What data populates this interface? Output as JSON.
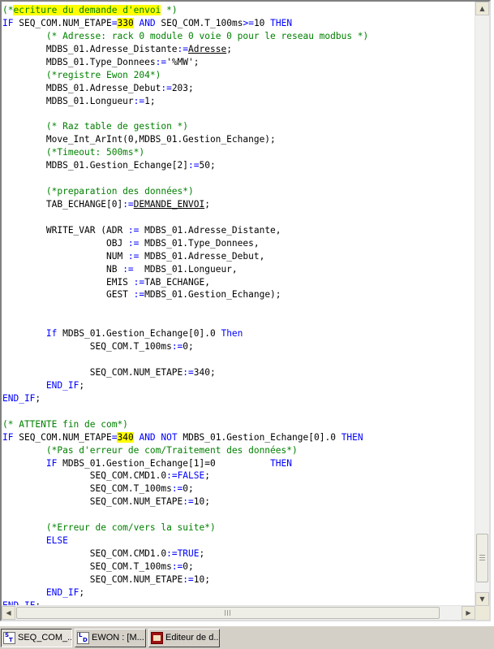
{
  "editor": {
    "lines": [
      {
        "segs": [
          {
            "t": "(*",
            "c": "cm"
          },
          {
            "t": "ecriture du demande d'envoi",
            "c": "cm hl"
          },
          {
            "t": " *)",
            "c": "cm"
          }
        ]
      },
      {
        "segs": [
          {
            "t": "IF",
            "c": "kw"
          },
          {
            "t": " SEQ_COM.NUM_ETAPE"
          },
          {
            "t": "=",
            "c": "kw"
          },
          {
            "t": "330",
            "c": "hl"
          },
          {
            "t": " "
          },
          {
            "t": "AND",
            "c": "kw"
          },
          {
            "t": " SEQ_COM.T_100ms"
          },
          {
            "t": ">=",
            "c": "kw"
          },
          {
            "t": "10 "
          },
          {
            "t": "THEN",
            "c": "kw"
          }
        ]
      },
      {
        "segs": [
          {
            "t": "        "
          },
          {
            "t": "(* Adresse: rack 0 module 0 voie 0 pour le reseau modbus *)",
            "c": "cm"
          }
        ]
      },
      {
        "segs": [
          {
            "t": "        MDBS_01.Adresse_Distante"
          },
          {
            "t": ":=",
            "c": "kw"
          },
          {
            "t": "Adresse",
            "c": "ul"
          },
          {
            "t": ";"
          }
        ]
      },
      {
        "segs": [
          {
            "t": "        MDBS_01.Type_Donnees"
          },
          {
            "t": ":=",
            "c": "kw"
          },
          {
            "t": "'%MW'"
          },
          {
            "t": ";"
          }
        ]
      },
      {
        "segs": [
          {
            "t": "        "
          },
          {
            "t": "(*registre Ewon 204*)",
            "c": "cm"
          }
        ]
      },
      {
        "segs": [
          {
            "t": "        MDBS_01.Adresse_Debut"
          },
          {
            "t": ":=",
            "c": "kw"
          },
          {
            "t": "203;"
          }
        ]
      },
      {
        "segs": [
          {
            "t": "        MDBS_01.Longueur"
          },
          {
            "t": ":=",
            "c": "kw"
          },
          {
            "t": "1;"
          }
        ]
      },
      {
        "segs": []
      },
      {
        "segs": [
          {
            "t": "        "
          },
          {
            "t": "(* Raz table de gestion *)",
            "c": "cm"
          }
        ]
      },
      {
        "segs": [
          {
            "t": "        Move_Int_ArInt(0,MDBS_01.Gestion_Echange);"
          }
        ]
      },
      {
        "segs": [
          {
            "t": "        "
          },
          {
            "t": "(*Timeout: 500ms*)",
            "c": "cm"
          }
        ]
      },
      {
        "segs": [
          {
            "t": "        MDBS_01.Gestion_Echange[2]"
          },
          {
            "t": ":=",
            "c": "kw"
          },
          {
            "t": "50;"
          }
        ]
      },
      {
        "segs": []
      },
      {
        "segs": [
          {
            "t": "        "
          },
          {
            "t": "(*preparation des données*)",
            "c": "cm"
          }
        ]
      },
      {
        "segs": [
          {
            "t": "        TAB_ECHANGE[0]"
          },
          {
            "t": ":=",
            "c": "kw"
          },
          {
            "t": "DEMANDE_ENVOI",
            "c": "ul"
          },
          {
            "t": ";"
          }
        ]
      },
      {
        "segs": []
      },
      {
        "segs": [
          {
            "t": "        WRITE_VAR (ADR "
          },
          {
            "t": ":=",
            "c": "kw"
          },
          {
            "t": " MDBS_01.Adresse_Distante,"
          }
        ]
      },
      {
        "segs": [
          {
            "t": "                   OBJ "
          },
          {
            "t": ":=",
            "c": "kw"
          },
          {
            "t": " MDBS_01.Type_Donnees,"
          }
        ]
      },
      {
        "segs": [
          {
            "t": "                   NUM "
          },
          {
            "t": ":=",
            "c": "kw"
          },
          {
            "t": " MDBS_01.Adresse_Debut,"
          }
        ]
      },
      {
        "segs": [
          {
            "t": "                   NB "
          },
          {
            "t": ":=",
            "c": "kw"
          },
          {
            "t": "  MDBS_01.Longueur,"
          }
        ]
      },
      {
        "segs": [
          {
            "t": "                   EMIS "
          },
          {
            "t": ":=",
            "c": "kw"
          },
          {
            "t": "TAB_ECHANGE,"
          }
        ]
      },
      {
        "segs": [
          {
            "t": "                   GEST "
          },
          {
            "t": ":=",
            "c": "kw"
          },
          {
            "t": "MDBS_01.Gestion_Echange);"
          }
        ]
      },
      {
        "segs": []
      },
      {
        "segs": []
      },
      {
        "segs": [
          {
            "t": "        "
          },
          {
            "t": "If",
            "c": "kw"
          },
          {
            "t": " MDBS_01.Gestion_Echange[0].0 "
          },
          {
            "t": "Then",
            "c": "kw"
          }
        ]
      },
      {
        "segs": [
          {
            "t": "                SEQ_COM.T_100ms"
          },
          {
            "t": ":=",
            "c": "kw"
          },
          {
            "t": "0;"
          }
        ]
      },
      {
        "segs": []
      },
      {
        "segs": [
          {
            "t": "                SEQ_COM.NUM_ETAPE"
          },
          {
            "t": ":=",
            "c": "kw"
          },
          {
            "t": "340;"
          }
        ]
      },
      {
        "segs": [
          {
            "t": "        "
          },
          {
            "t": "END_IF",
            "c": "kw"
          },
          {
            "t": ";"
          }
        ]
      },
      {
        "segs": [
          {
            "t": "END_IF",
            "c": "kw"
          },
          {
            "t": ";"
          }
        ]
      },
      {
        "segs": []
      },
      {
        "segs": [
          {
            "t": "(* ATTENTE fin de com*)",
            "c": "cm"
          }
        ]
      },
      {
        "segs": [
          {
            "t": "IF",
            "c": "kw"
          },
          {
            "t": " SEQ_COM.NUM_ETAPE"
          },
          {
            "t": "=",
            "c": "kw"
          },
          {
            "t": "340",
            "c": "hl"
          },
          {
            "t": " "
          },
          {
            "t": "AND NOT",
            "c": "kw"
          },
          {
            "t": " MDBS_01.Gestion_Echange[0].0 "
          },
          {
            "t": "THEN",
            "c": "kw"
          }
        ]
      },
      {
        "segs": [
          {
            "t": "        "
          },
          {
            "t": "(*Pas d'erreur de com/Traitement des données*)",
            "c": "cm"
          }
        ]
      },
      {
        "segs": [
          {
            "t": "        "
          },
          {
            "t": "IF",
            "c": "kw"
          },
          {
            "t": " MDBS_01.Gestion_Echange[1]=0          "
          },
          {
            "t": "THEN",
            "c": "kw"
          }
        ]
      },
      {
        "segs": [
          {
            "t": "                SEQ_COM.CMD1.0"
          },
          {
            "t": ":=",
            "c": "kw"
          },
          {
            "t": "FALSE",
            "c": "kw"
          },
          {
            "t": ";"
          }
        ]
      },
      {
        "segs": [
          {
            "t": "                SEQ_COM.T_100ms"
          },
          {
            "t": ":=",
            "c": "kw"
          },
          {
            "t": "0;"
          }
        ]
      },
      {
        "segs": [
          {
            "t": "                SEQ_COM.NUM_ETAPE"
          },
          {
            "t": ":=",
            "c": "kw"
          },
          {
            "t": "10;"
          }
        ]
      },
      {
        "segs": []
      },
      {
        "segs": [
          {
            "t": "        "
          },
          {
            "t": "(*Erreur de com/vers la suite*)",
            "c": "cm"
          }
        ]
      },
      {
        "segs": [
          {
            "t": "        "
          },
          {
            "t": "ELSE",
            "c": "kw"
          }
        ]
      },
      {
        "segs": [
          {
            "t": "                SEQ_COM.CMD1.0"
          },
          {
            "t": ":=",
            "c": "kw"
          },
          {
            "t": "TRUE",
            "c": "kw"
          },
          {
            "t": ";"
          }
        ]
      },
      {
        "segs": [
          {
            "t": "                SEQ_COM.T_100ms"
          },
          {
            "t": ":=",
            "c": "kw"
          },
          {
            "t": "0;"
          }
        ]
      },
      {
        "segs": [
          {
            "t": "                SEQ_COM.NUM_ETAPE"
          },
          {
            "t": ":=",
            "c": "kw"
          },
          {
            "t": "10;"
          }
        ]
      },
      {
        "segs": [
          {
            "t": "        "
          },
          {
            "t": "END_IF",
            "c": "kw"
          },
          {
            "t": ";"
          }
        ]
      },
      {
        "segs": [
          {
            "t": "END_IF",
            "c": "kw"
          },
          {
            "t": ";"
          }
        ]
      }
    ]
  },
  "colors": {
    "keyword": "#0000ff",
    "comment": "#008000",
    "highlight": "#ffff00"
  },
  "taskbar": {
    "tabs": [
      {
        "label": "SEQ_COM_...",
        "icon": "st-icon",
        "active": true
      },
      {
        "label": "EWON : [M...",
        "icon": "ld-icon",
        "active": false
      },
      {
        "label": "Editeur de d...",
        "icon": "dde-editor-icon",
        "active": false
      }
    ]
  },
  "scrollbars": {
    "up_glyph": "▲",
    "down_glyph": "▼",
    "left_glyph": "◀",
    "right_glyph": "▶"
  }
}
